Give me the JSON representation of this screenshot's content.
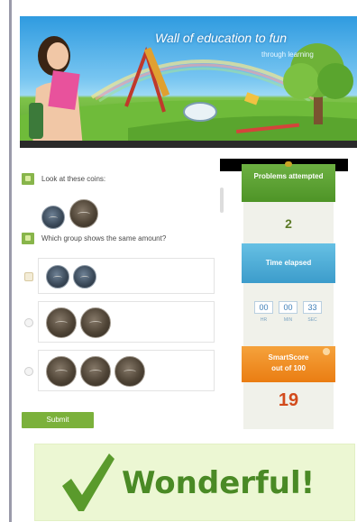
{
  "banner": {
    "title": "Wall of education to fun",
    "subtitle": "through learning"
  },
  "questions": [
    {
      "text": "Look at these coins:"
    },
    {
      "text": "Which group shows the same amount?"
    }
  ],
  "answer_options": [
    {
      "coin_type": "silver",
      "coin_count": 2,
      "selected": true
    },
    {
      "coin_type": "copper",
      "coin_count": 2,
      "selected": false
    },
    {
      "coin_type": "copper",
      "coin_count": 3,
      "selected": false
    }
  ],
  "submit_label": "Submit",
  "panel": {
    "problems_label": "Problems attempted",
    "problems_value": "2",
    "time_label": "Time elapsed",
    "time": {
      "hours": "00",
      "minutes": "00",
      "seconds": "33"
    },
    "time_units": {
      "hours": "HR",
      "minutes": "MIN",
      "seconds": "SEC"
    },
    "score_label": "SmartScore",
    "score_sublabel": "out of 100",
    "score_value": "19"
  },
  "feedback": {
    "text": "Wonderful!"
  },
  "colors": {
    "accent_green": "#7bb13b",
    "panel_blue": "#3c9ccb",
    "panel_orange": "#ea7d12",
    "score_red": "#d24a1b",
    "feedback_green": "#4a8a25"
  },
  "icons": [
    "check-icon",
    "coin-icon",
    "info-icon"
  ]
}
